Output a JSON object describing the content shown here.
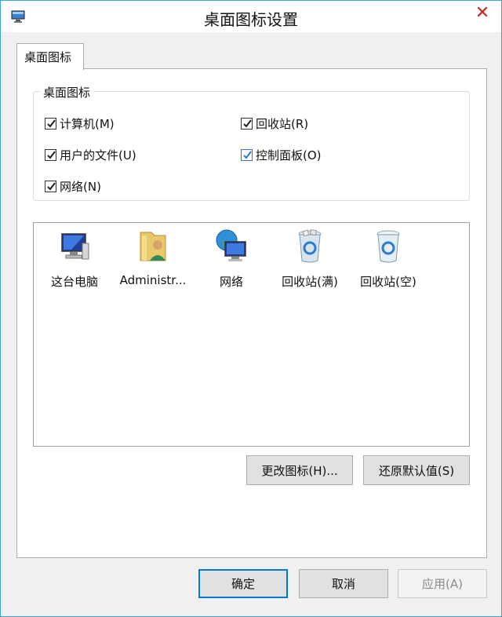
{
  "window": {
    "title": "桌面图标设置",
    "accent": "#3aa0dc"
  },
  "tabs": [
    {
      "label": "桌面图标"
    }
  ],
  "group": {
    "title": "桌面图标",
    "checkboxes": [
      {
        "label": "计算机(M)",
        "checked": true
      },
      {
        "label": "回收站(R)",
        "checked": true
      },
      {
        "label": "用户的文件(U)",
        "checked": true
      },
      {
        "label": "控制面板(O)",
        "checked": true
      },
      {
        "label": "网络(N)",
        "checked": true
      }
    ]
  },
  "icons": [
    {
      "label": "这台电脑",
      "icon": "computer-icon"
    },
    {
      "label": "Administr...",
      "icon": "user-folder-icon"
    },
    {
      "label": "网络",
      "icon": "network-icon"
    },
    {
      "label": "回收站(满)",
      "icon": "recycle-bin-full-icon"
    },
    {
      "label": "回收站(空)",
      "icon": "recycle-bin-empty-icon"
    }
  ],
  "buttons": {
    "change_icon": "更改图标(H)...",
    "restore_default": "还原默认值(S)",
    "ok": "确定",
    "cancel": "取消",
    "apply": "应用(A)"
  }
}
